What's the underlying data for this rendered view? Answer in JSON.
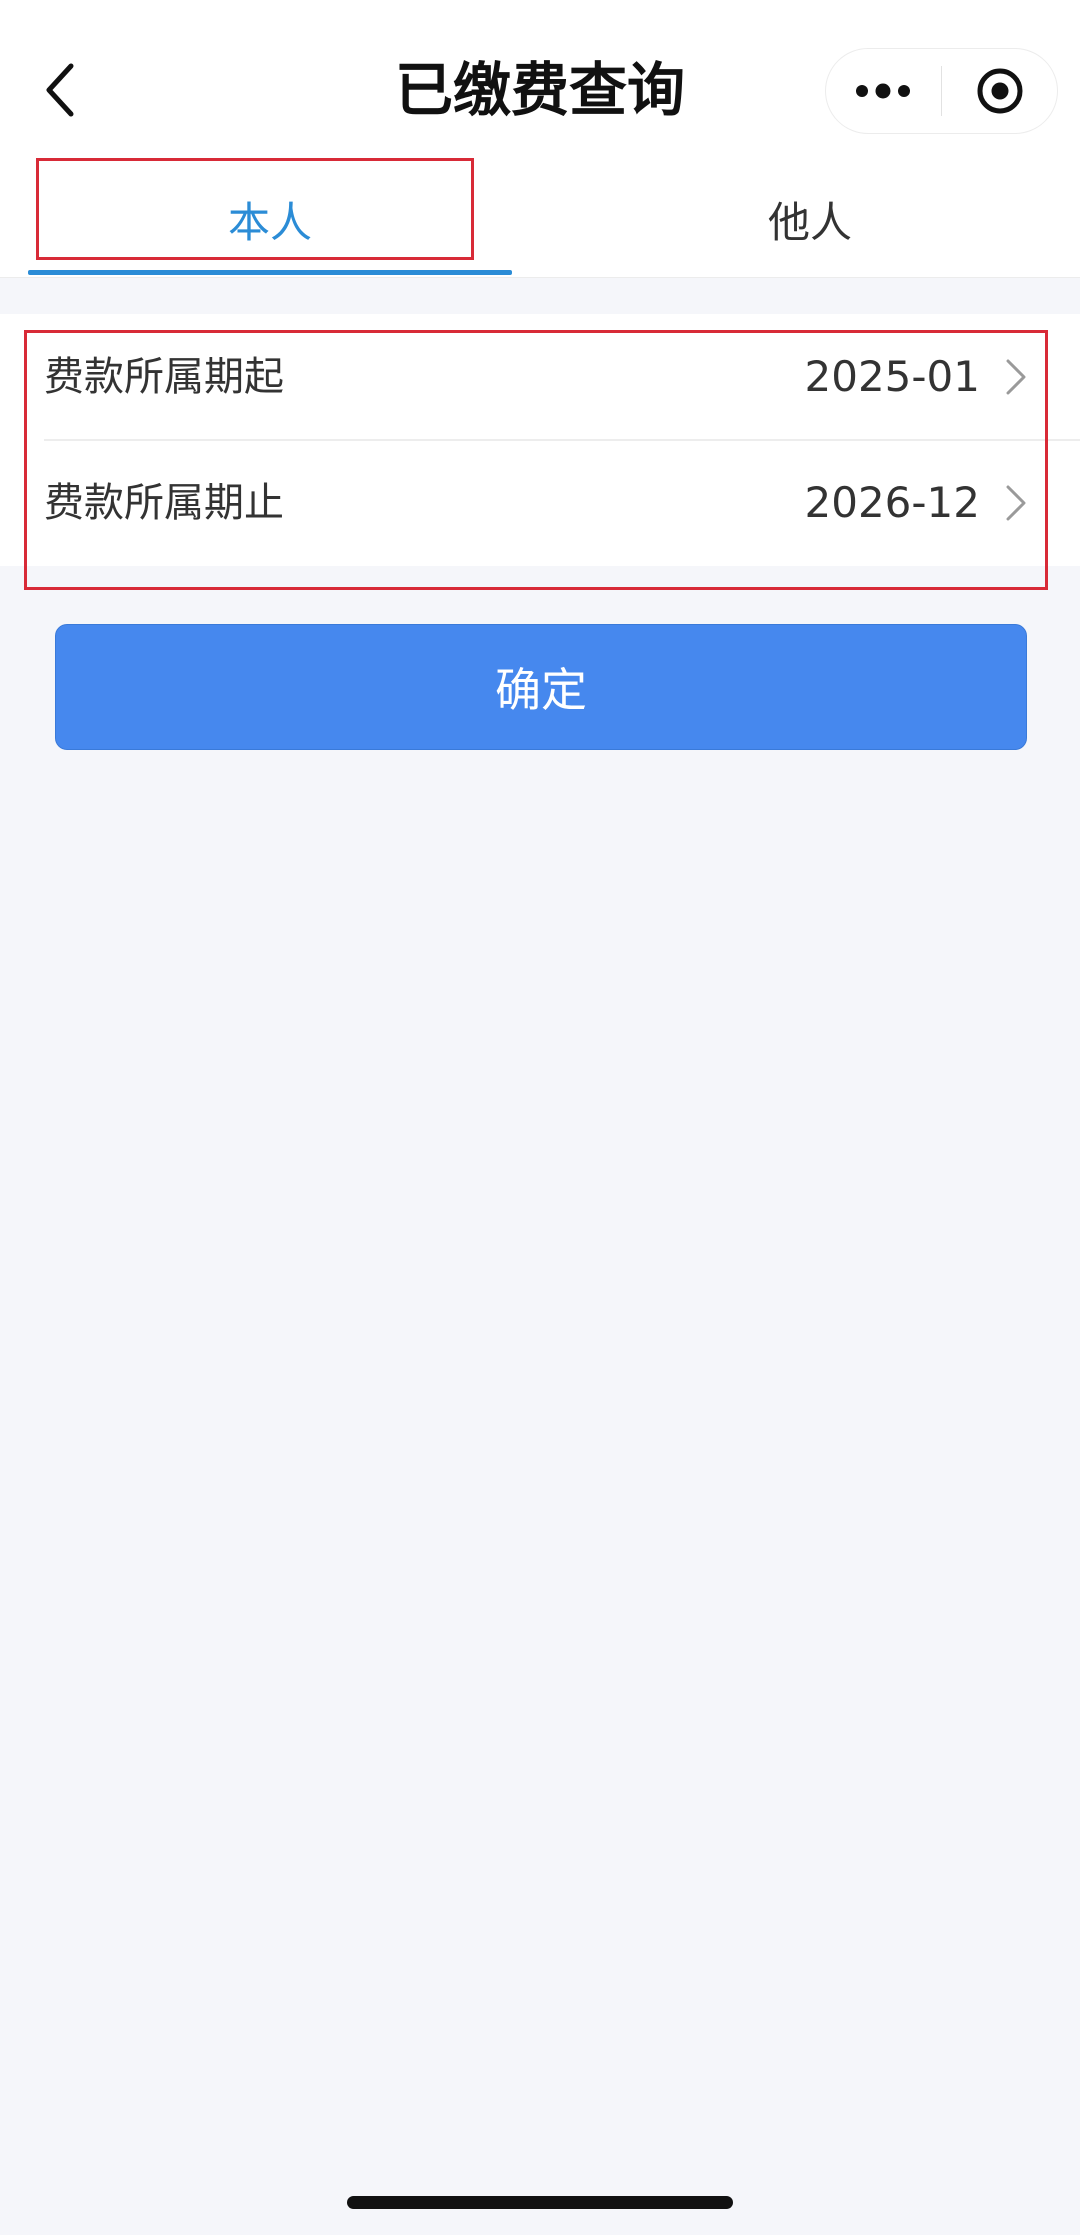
{
  "header": {
    "title": "已缴费查询",
    "back_icon": "chevron-left-icon",
    "more_icon": "more-dots-icon",
    "close_icon": "target-circle-icon"
  },
  "tabs": [
    {
      "label": "本人",
      "active": true
    },
    {
      "label": "他人",
      "active": false
    }
  ],
  "form": {
    "rows": [
      {
        "label": "费款所属期起",
        "value": "2025-01",
        "icon": "chevron-right-icon"
      },
      {
        "label": "费款所属期止",
        "value": "2026-12",
        "icon": "chevron-right-icon"
      }
    ]
  },
  "confirm_button": {
    "label": "确定"
  },
  "colors": {
    "accent": "#2b8cd6",
    "button": "#4688ee",
    "highlight": "#d82a37",
    "background": "#f5f6fa"
  }
}
